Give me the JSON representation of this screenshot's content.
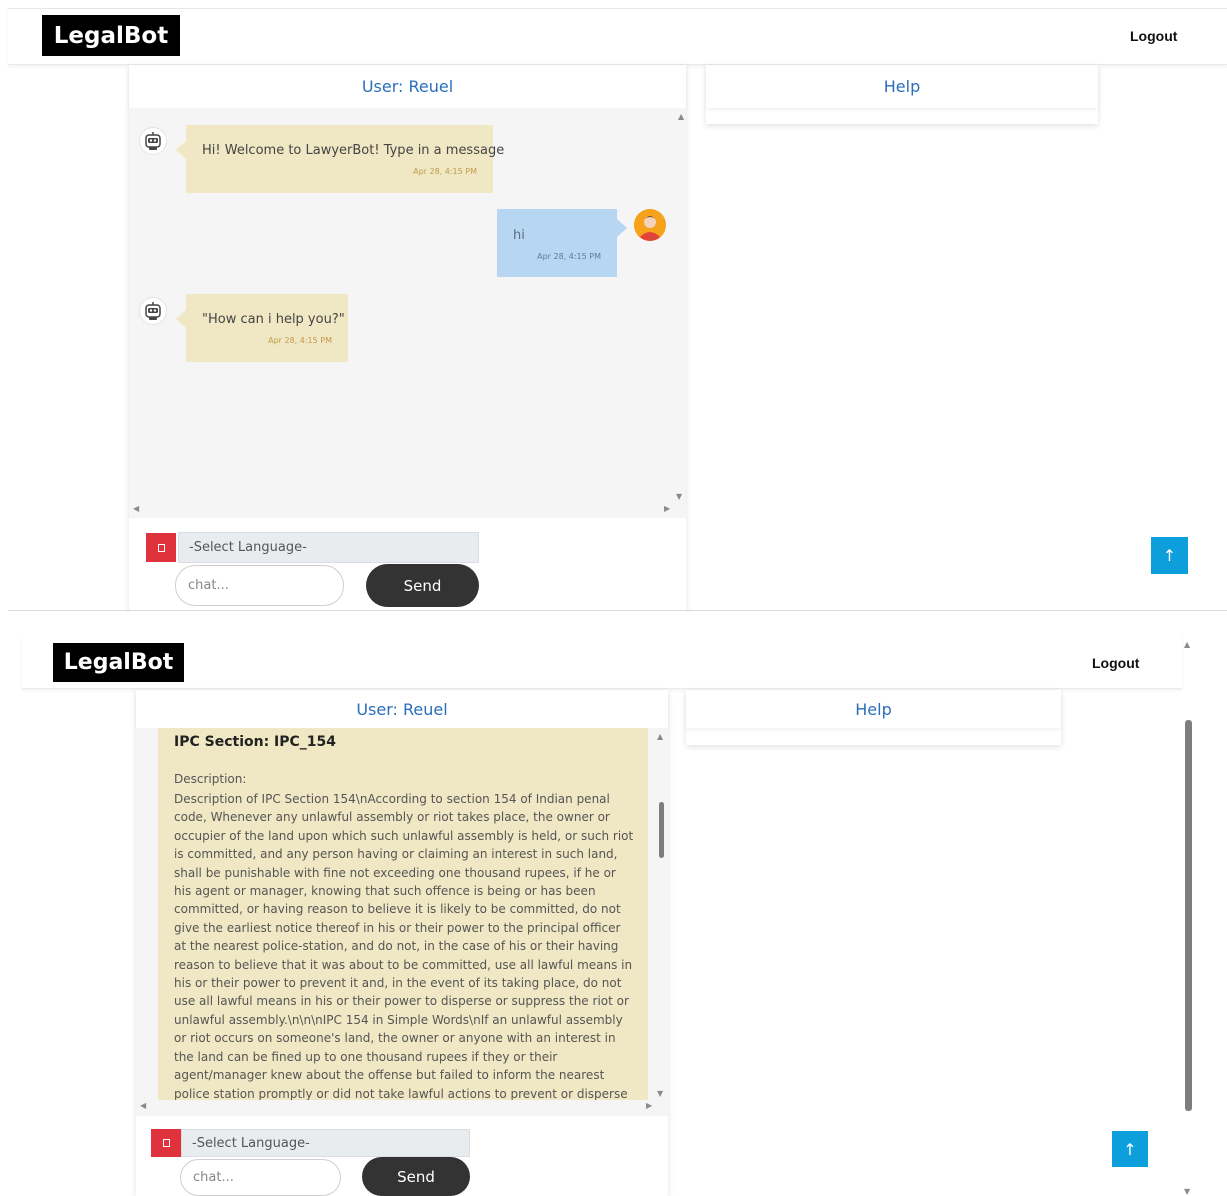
{
  "app": {
    "brand": "LegalBot",
    "logout_label": "Logout"
  },
  "screen1": {
    "chat_header": "User: Reuel",
    "help_header": "Help",
    "messages": [
      {
        "sender": "bot",
        "text": "Hi! Welcome to LawyerBot! Type in a message",
        "time": "Apr 28, 4:15 PM"
      },
      {
        "sender": "user",
        "text": "hi",
        "time": "Apr 28, 4:15 PM"
      },
      {
        "sender": "bot",
        "text": "\"How can i help you?\"",
        "time": "Apr 28, 4:15 PM"
      }
    ],
    "language_select": "-Select Language-",
    "chat_placeholder": "chat...",
    "send_label": "Send",
    "scroll_top_icon": "↑"
  },
  "screen2": {
    "chat_header": "User: Reuel",
    "help_header": "Help",
    "ipc_title": "IPC Section: IPC_154",
    "description_label": "Description:",
    "description_text": "Description of IPC Section 154\\nAccording to section 154 of Indian penal code, Whenever any unlawful assembly or riot takes place, the owner or occupier of the land upon which such unlawful assembly is held, or such riot is committed, and any person having or claiming an interest in such land, shall be punishable with fine not exceeding one thousand rupees, if he or his agent or manager, knowing that such offence is being or has been committed, or having reason to believe it is likely to be committed, do not give the earliest notice thereof in his or their power to the principal officer at the nearest police-station, and do not, in the case of his or their having reason to believe that it was about to be committed, use all lawful means in his or their power to prevent it and, in the event of its taking place, do not use all lawful means in his or their power to disperse or suppress the riot or unlawful assembly.\\n\\n\\nIPC 154 in Simple Words\\nIf an unlawful assembly or riot occurs on someone's land, the owner or anyone with an interest in the land can be fined up to one thousand rupees if they or their agent/manager knew about the offense but failed to inform the nearest police station promptly or did not take lawful actions to prevent or disperse the riot or assembly.",
    "language_select": "-Select Language-",
    "chat_placeholder": "chat...",
    "send_label": "Send",
    "scroll_top_icon": "↑"
  },
  "colors": {
    "brand_bg": "#000000",
    "header_text": "#2a6ebb",
    "bot_bubble": "#f0e8c4",
    "user_bubble": "#b7d6f1",
    "send_button": "#333333",
    "scroll_top_button": "#0d9fdc",
    "language_flag": "#e0323d"
  },
  "icons": [
    "robot-avatar-icon",
    "user-avatar-icon",
    "language-flag-icon",
    "arrow-up-icon",
    "scroll-arrow-icon"
  ]
}
